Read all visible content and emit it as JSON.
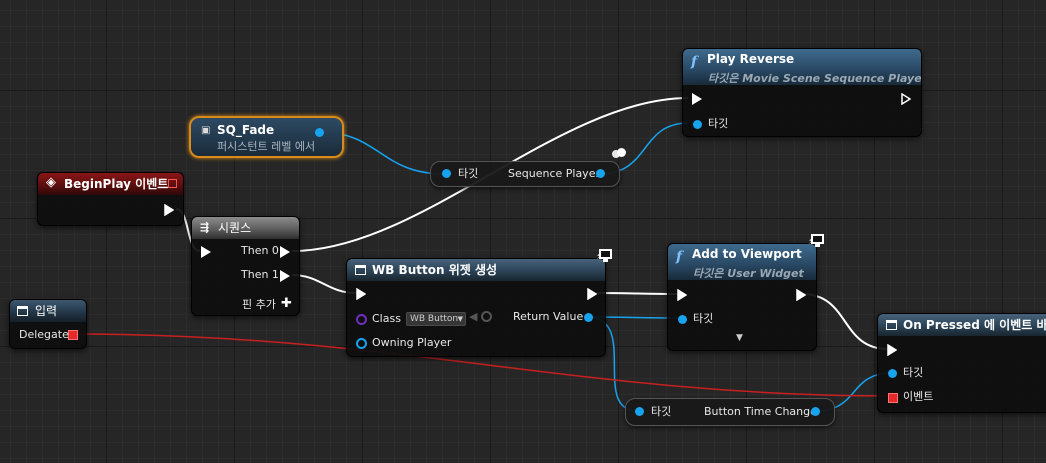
{
  "nodes": {
    "play_reverse": {
      "title": "Play Reverse",
      "subtitle": "타깃은 Movie Scene Sequence Player",
      "target_label": "타깃"
    },
    "sq_fade": {
      "title": "SQ_Fade",
      "subtitle": "퍼시스턴트 레벨 에서"
    },
    "begin_play": {
      "title": "BeginPlay 이벤트"
    },
    "sequence": {
      "title": "시퀀스",
      "then0": "Then 0",
      "then1": "Then 1",
      "add_pin": "핀 추가"
    },
    "sequence_player": {
      "target_label": "타깃",
      "output_label": "Sequence Player"
    },
    "create_widget": {
      "title": "WB Button 위젯 생성",
      "class_label": "Class",
      "class_value": "WB Button",
      "owning_player": "Owning Player",
      "return_value": "Return Value"
    },
    "add_to_viewport": {
      "title": "Add to Viewport",
      "subtitle": "타깃은 User Widget",
      "target_label": "타깃"
    },
    "input": {
      "title": "입력",
      "delegate_label": "Delegate"
    },
    "on_pressed": {
      "title": "On Pressed 에 이벤트 바인딩",
      "target_label": "타깃",
      "event_label": "이벤트"
    },
    "button_time_change": {
      "target_label": "타깃",
      "output_label": "Button Time Change"
    }
  },
  "colors": {
    "exec_wire": "#ffffff",
    "object_wire": "#17a3ee",
    "delegate_wire": "#e52a2a",
    "class_pin": "#6e2fbb",
    "func_header": "#2a4a66",
    "event_header": "#5c0e0e",
    "sq_fade_border": "#d88a1a"
  },
  "icons": {
    "function": "function-f-icon",
    "event": "event-diamond-icon",
    "sequence": "sequence-icon",
    "widget": "widget-icon",
    "variable": "actor-variable-icon",
    "context": "monitor-icon",
    "add": "plus-icon",
    "expand": "chevron-down-icon",
    "dropdown": "dropdown-arrow-icon",
    "browse": "arrow-left-icon",
    "search": "search-icon"
  }
}
